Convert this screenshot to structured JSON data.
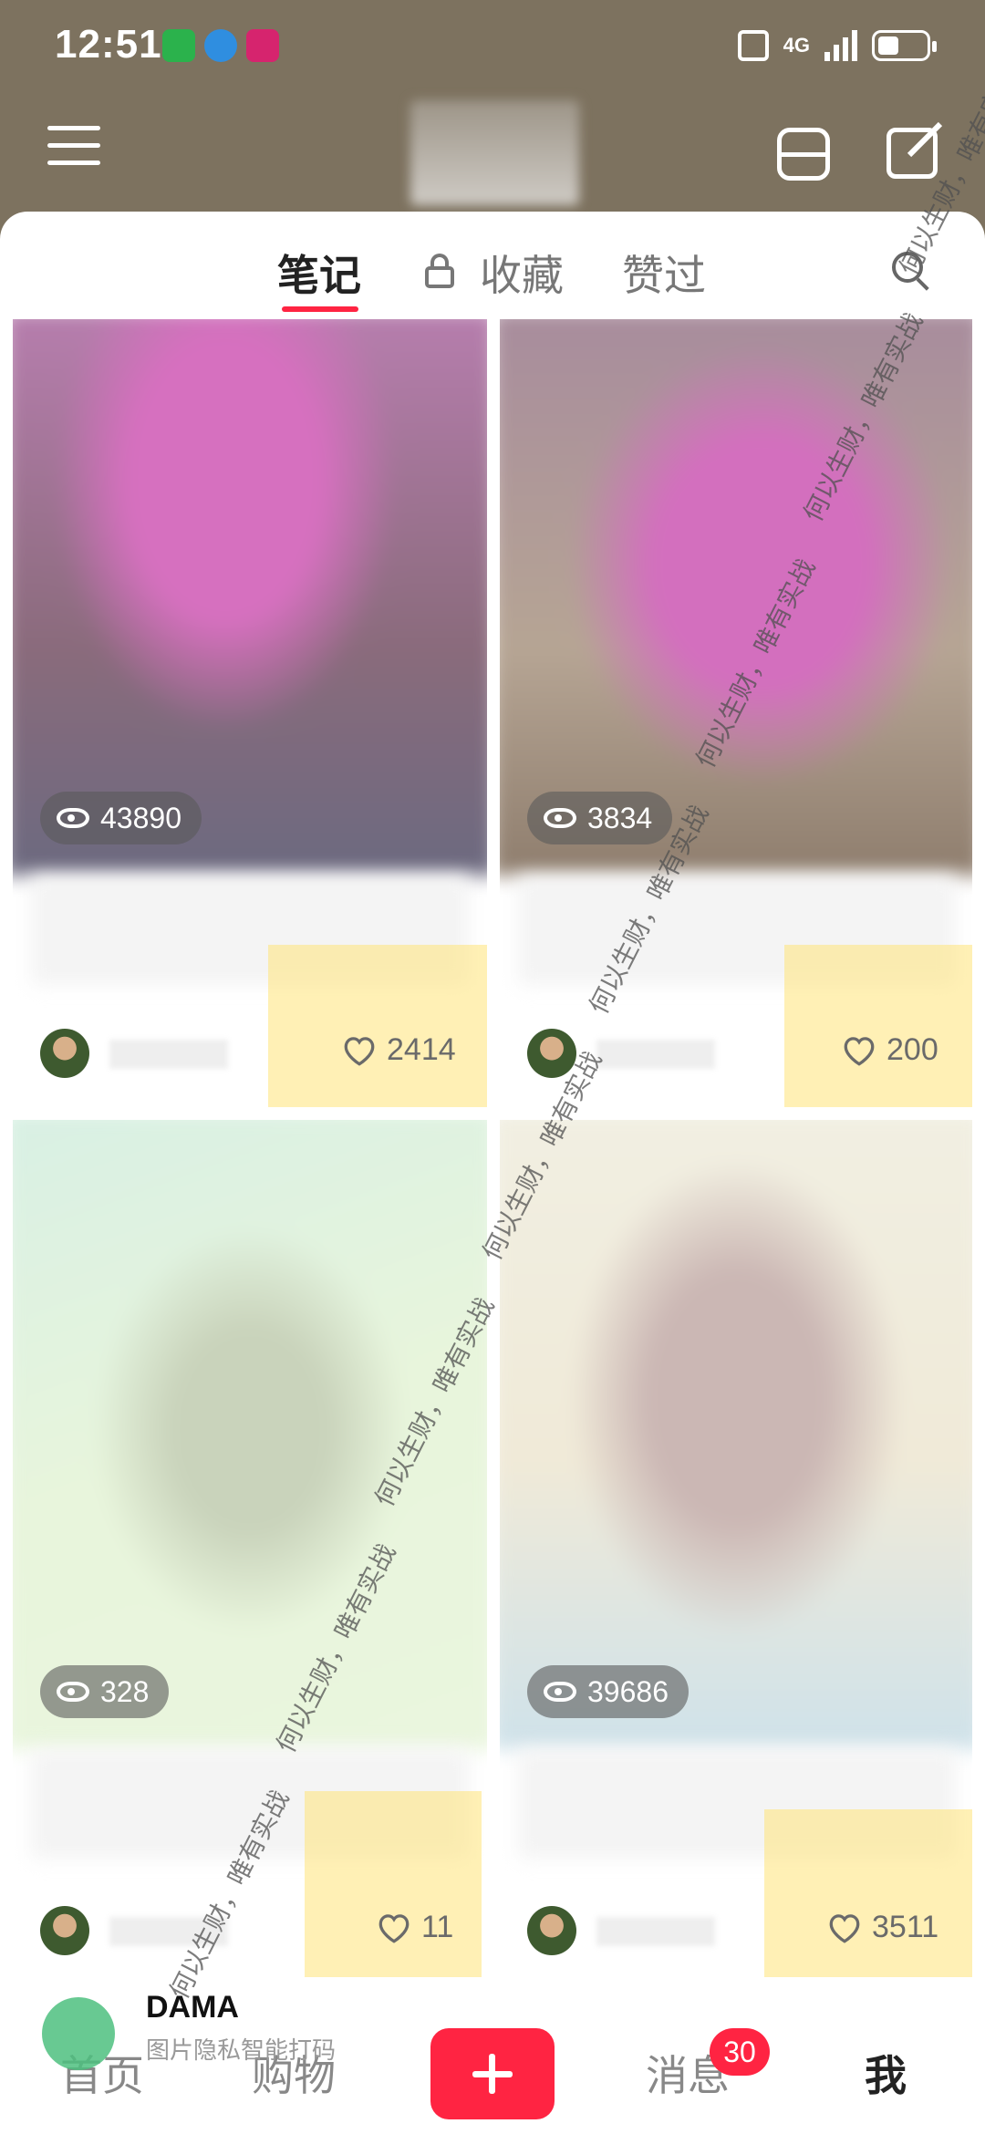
{
  "status_bar": {
    "time": "12:51",
    "network": "4G"
  },
  "tabs": {
    "notes": "笔记",
    "favorites": "收藏",
    "liked": "赞过"
  },
  "cards": [
    {
      "views": "43890",
      "likes": "2414"
    },
    {
      "views": "3834",
      "likes": "200"
    },
    {
      "views": "328",
      "likes": "11"
    },
    {
      "views": "39686",
      "likes": "3511"
    }
  ],
  "bottom_nav": {
    "home": "首页",
    "shop": "购物",
    "messages": "消息",
    "messages_badge": "30",
    "me": "我"
  },
  "watermark": {
    "brand": "DAMA",
    "subtitle": "图片隐私智能打码",
    "slogan": "何以生财，唯有实战"
  },
  "colors": {
    "header_bg": "#7d725f",
    "accent": "#ff2442"
  }
}
